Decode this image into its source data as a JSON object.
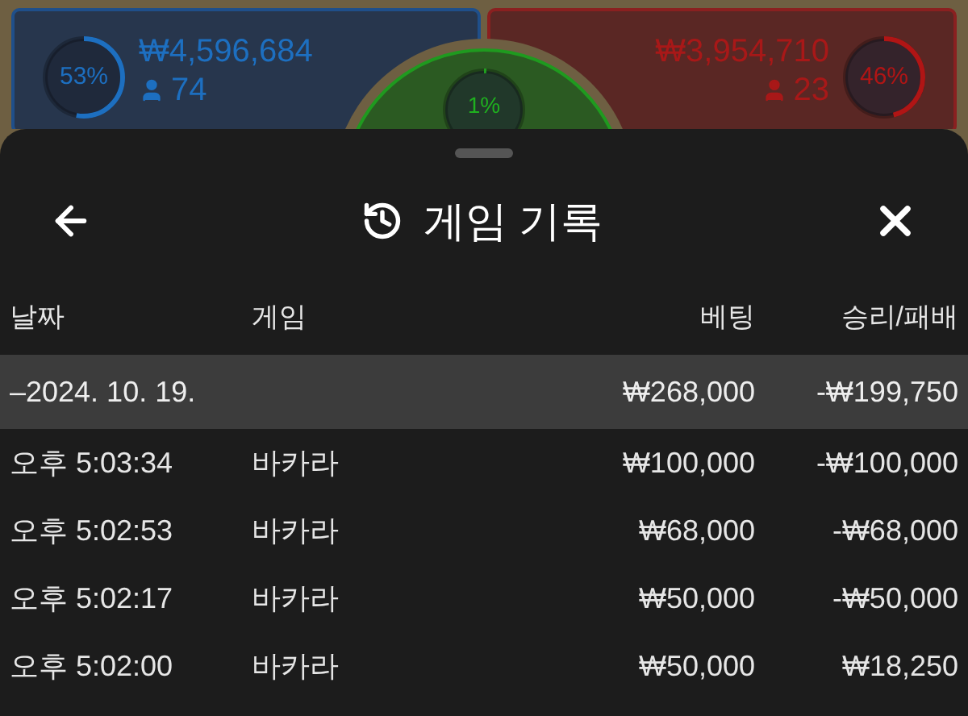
{
  "board": {
    "left": {
      "percent": "53%",
      "amount": "₩4,596,684",
      "players": "74"
    },
    "center": {
      "percent": "1%"
    },
    "right": {
      "percent": "46%",
      "amount": "₩3,954,710",
      "players": "23"
    }
  },
  "sheet": {
    "title": "게임 기록"
  },
  "table": {
    "columns": [
      "날짜",
      "게임",
      "베팅",
      "승리/패배"
    ],
    "group": {
      "date": "–2024. 10. 19.",
      "bet": "₩268,000",
      "result": "-₩199,750",
      "expanded": true
    },
    "rows": [
      {
        "time": "오후 5:03:34",
        "game": "바카라",
        "bet": "₩100,000",
        "result": "-₩100,000"
      },
      {
        "time": "오후 5:02:53",
        "game": "바카라",
        "bet": "₩68,000",
        "result": "-₩68,000"
      },
      {
        "time": "오후 5:02:17",
        "game": "바카라",
        "bet": "₩50,000",
        "result": "-₩50,000"
      },
      {
        "time": "오후 5:02:00",
        "game": "바카라",
        "bet": "₩50,000",
        "result": "₩18,250"
      }
    ]
  }
}
